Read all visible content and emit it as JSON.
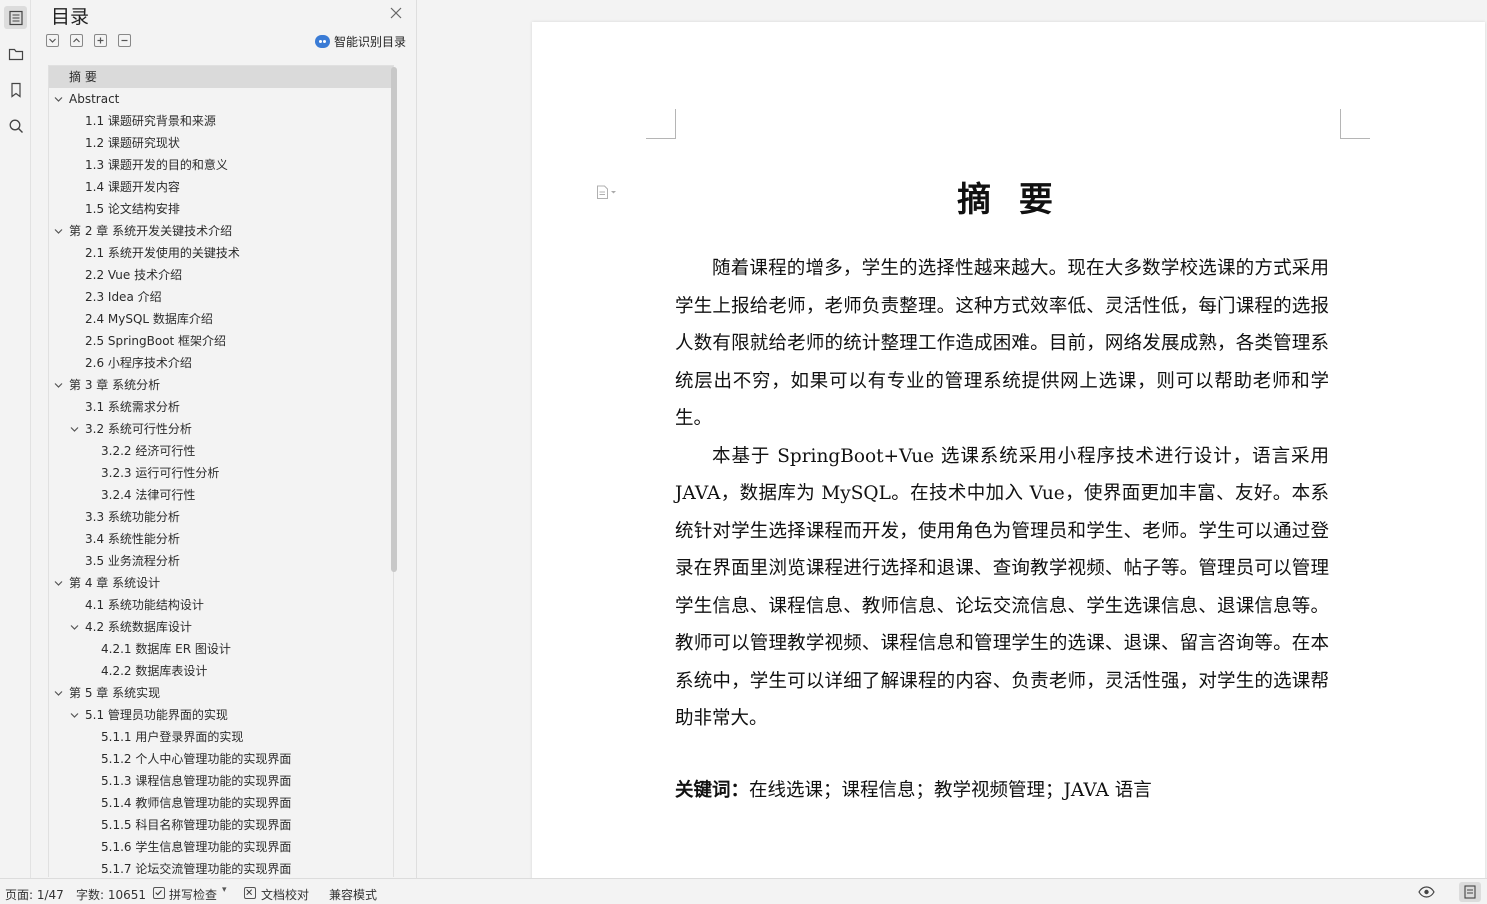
{
  "rail": {
    "icons": [
      "toc-icon",
      "folder-icon",
      "bookmark-icon",
      "search-icon"
    ]
  },
  "toc_panel": {
    "title": "目录",
    "smart_label": "智能识别目录",
    "items": [
      {
        "label": "摘  要",
        "level": 0,
        "arrow": "none",
        "selected": true
      },
      {
        "label": "Abstract",
        "level": 0,
        "arrow": "down"
      },
      {
        "label": "1.1 课题研究背景和来源",
        "level": 1,
        "arrow": "none"
      },
      {
        "label": "1.2 课题研究现状",
        "level": 1,
        "arrow": "none"
      },
      {
        "label": "1.3 课题开发的目的和意义",
        "level": 1,
        "arrow": "none"
      },
      {
        "label": "1.4 课题开发内容",
        "level": 1,
        "arrow": "none"
      },
      {
        "label": "1.5 论文结构安排",
        "level": 1,
        "arrow": "none"
      },
      {
        "label": "第 2 章  系统开发关键技术介绍",
        "level": 0,
        "arrow": "down"
      },
      {
        "label": "2.1 系统开发使用的关键技术",
        "level": 1,
        "arrow": "none"
      },
      {
        "label": "2.2 Vue 技术介绍",
        "level": 1,
        "arrow": "none"
      },
      {
        "label": "2.3 Idea 介绍",
        "level": 1,
        "arrow": "none"
      },
      {
        "label": "2.4 MySQL 数据库介绍",
        "level": 1,
        "arrow": "none"
      },
      {
        "label": "2.5 SpringBoot 框架介绍",
        "level": 1,
        "arrow": "none"
      },
      {
        "label": "2.6 小程序技术介绍",
        "level": 1,
        "arrow": "none"
      },
      {
        "label": "第 3 章  系统分析",
        "level": 0,
        "arrow": "down"
      },
      {
        "label": "3.1 系统需求分析",
        "level": 1,
        "arrow": "none"
      },
      {
        "label": "3.2 系统可行性分析",
        "level": 1,
        "arrow": "down"
      },
      {
        "label": "3.2.2 经济可行性",
        "level": 2,
        "arrow": "none"
      },
      {
        "label": "3.2.3 运行可行性分析",
        "level": 2,
        "arrow": "none"
      },
      {
        "label": "3.2.4 法律可行性",
        "level": 2,
        "arrow": "none"
      },
      {
        "label": "3.3 系统功能分析",
        "level": 1,
        "arrow": "none"
      },
      {
        "label": "3.4 系统性能分析",
        "level": 1,
        "arrow": "none"
      },
      {
        "label": "3.5 业务流程分析",
        "level": 1,
        "arrow": "none"
      },
      {
        "label": "第 4 章  系统设计",
        "level": 0,
        "arrow": "down"
      },
      {
        "label": "4.1 系统功能结构设计",
        "level": 1,
        "arrow": "none"
      },
      {
        "label": "4.2 系统数据库设计",
        "level": 1,
        "arrow": "down"
      },
      {
        "label": "4.2.1 数据库 ER 图设计",
        "level": 2,
        "arrow": "none"
      },
      {
        "label": "4.2.2 数据库表设计",
        "level": 2,
        "arrow": "none"
      },
      {
        "label": "第 5 章  系统实现",
        "level": 0,
        "arrow": "down"
      },
      {
        "label": "5.1 管理员功能界面的实现",
        "level": 1,
        "arrow": "down"
      },
      {
        "label": "5.1.1 用户登录界面的实现",
        "level": 2,
        "arrow": "none"
      },
      {
        "label": "5.1.2 个人中心管理功能的实现界面",
        "level": 2,
        "arrow": "none"
      },
      {
        "label": "5.1.3 课程信息管理功能的实现界面",
        "level": 2,
        "arrow": "none"
      },
      {
        "label": "5.1.4 教师信息管理功能的实现界面",
        "level": 2,
        "arrow": "none"
      },
      {
        "label": "5.1.5 科目名称管理功能的实现界面",
        "level": 2,
        "arrow": "none"
      },
      {
        "label": "5.1.6 学生信息管理功能的实现界面",
        "level": 2,
        "arrow": "none"
      },
      {
        "label": "5.1.7 论坛交流管理功能的实现界面",
        "level": 2,
        "arrow": "none"
      }
    ]
  },
  "document": {
    "title": "摘  要",
    "paragraphs": [
      "随着课程的增多，学生的选择性越来越大。现在大多数学校选课的方式采用学生上报给老师，老师负责整理。这种方式效率低、灵活性低，每门课程的选报人数有限就给老师的统计整理工作造成困难。目前，网络发展成熟，各类管理系统层出不穷，如果可以有专业的管理系统提供网上选课，则可以帮助老师和学生。",
      "本基于 SpringBoot+Vue 选课系统采用小程序技术进行设计，语言采用 JAVA，数据库为 MySQL。在技术中加入 Vue，使界面更加丰富、友好。本系统针对学生选择课程而开发，使用角色为管理员和学生、老师。学生可以通过登录在界面里浏览课程进行选择和退课、查询教学视频、帖子等。管理员可以管理学生信息、课程信息、教师信息、论坛交流信息、学生选课信息、退课信息等。教师可以管理教学视频、课程信息和管理学生的选课、退课、留言咨询等。在本系统中，学生可以详细了解课程的内容、负责老师，灵活性强，对学生的选课帮助非常大。"
    ],
    "keywords_label": "关键词：",
    "keywords_value": "在线选课；课程信息；教学视频管理；JAVA 语言"
  },
  "status_bar": {
    "page": "页面: 1/47",
    "word_count": "字数: 10651",
    "spell_check": "拼写检查",
    "proofread": "文档校对",
    "compat_mode": "兼容模式"
  },
  "colors": {
    "background": "#f3f3f3",
    "selected_row": "#dadada",
    "smart_icon": "#3a7bd5"
  }
}
